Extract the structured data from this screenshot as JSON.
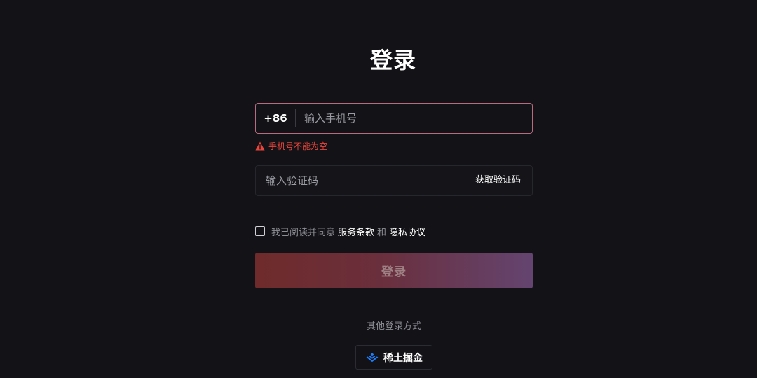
{
  "page": {
    "title": "登录"
  },
  "phone": {
    "prefix": "+86",
    "placeholder": "输入手机号",
    "error": "手机号不能为空"
  },
  "code": {
    "placeholder": "输入验证码",
    "get_code_label": "获取验证码"
  },
  "agreement": {
    "prefix": "我已阅读并同意",
    "terms_label": "服务条款",
    "and": "和",
    "privacy_label": "隐私协议",
    "checked": false
  },
  "login_button": {
    "label": "登录"
  },
  "other_login": {
    "divider_text": "其他登录方式",
    "providers": [
      {
        "label": "稀土掘金",
        "icon": "juejin-logo-icon"
      }
    ]
  },
  "colors": {
    "background": "#121217",
    "error": "#e8453c",
    "focus_border": "#b66b7e",
    "button_gradient_start": "#6f2b2b",
    "button_gradient_end": "#644470",
    "juejin_blue": "#1e80ff"
  }
}
